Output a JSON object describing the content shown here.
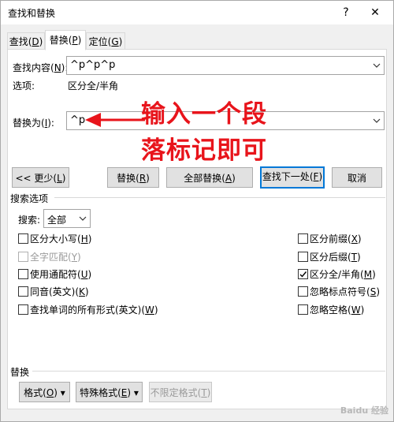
{
  "window": {
    "title": "查找和替换",
    "help_glyph": "?",
    "close_glyph": "✕"
  },
  "tabs": [
    {
      "label": "查找(",
      "key": "D",
      "end": ")"
    },
    {
      "label": "替换(",
      "key": "P",
      "end": ")"
    },
    {
      "label": "定位(",
      "key": "G",
      "end": ")"
    }
  ],
  "find": {
    "label": "查找内容(",
    "key": "N",
    "end": "):",
    "value": "^p^p^p",
    "options_label": "选项:",
    "options_value": "区分全/半角"
  },
  "replace": {
    "label": "替换为(",
    "key": "I",
    "end": "):",
    "value": "^p"
  },
  "annotation": {
    "line1": "输入一个段",
    "line2": "落标记即可",
    "color": "#e8141b"
  },
  "buttons": {
    "less": {
      "label": "<< 更少(",
      "key": "L",
      "end": ")"
    },
    "replace": {
      "label": "替换(",
      "key": "R",
      "end": ")"
    },
    "replace_all": {
      "label": "全部替换(",
      "key": "A",
      "end": ")"
    },
    "find_next": {
      "label": "查找下一处(",
      "key": "F",
      "end": ")"
    },
    "cancel": {
      "label": "取消"
    }
  },
  "search_options": {
    "title": "搜索选项",
    "search_label": "搜索:",
    "search_value": "全部",
    "left": [
      {
        "label": "区分大小写(",
        "key": "H",
        "end": ")",
        "checked": false,
        "disabled": false
      },
      {
        "label": "全字匹配(",
        "key": "Y",
        "end": ")",
        "checked": false,
        "disabled": true
      },
      {
        "label": "使用通配符(",
        "key": "U",
        "end": ")",
        "checked": false,
        "disabled": false
      },
      {
        "label": "同音(英文)(",
        "key": "K",
        "end": ")",
        "checked": false,
        "disabled": false
      },
      {
        "label": "查找单词的所有形式(英文)(",
        "key": "W",
        "end": ")",
        "checked": false,
        "disabled": false
      }
    ],
    "right": [
      {
        "label": "区分前缀(",
        "key": "X",
        "end": ")",
        "checked": false
      },
      {
        "label": "区分后缀(",
        "key": "T",
        "end": ")",
        "checked": false
      },
      {
        "label": "区分全/半角(",
        "key": "M",
        "end": ")",
        "checked": true
      },
      {
        "label": "忽略标点符号(",
        "key": "S",
        "end": ")",
        "checked": false
      },
      {
        "label": "忽略空格(",
        "key": "W",
        "end": ")",
        "checked": false
      }
    ]
  },
  "replace_section": {
    "title": "替换",
    "format": {
      "label": "格式(",
      "key": "O",
      "end": ") ▾"
    },
    "special": {
      "label": "特殊格式(",
      "key": "E",
      "end": ") ▾"
    },
    "no_format": {
      "label": "不限定格式(",
      "key": "T",
      "end": ")"
    }
  },
  "watermark": "Baidu 经验"
}
